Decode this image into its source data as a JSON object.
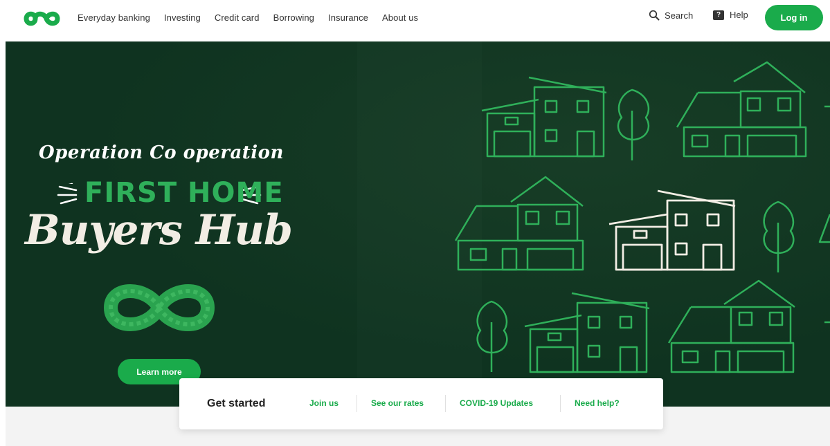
{
  "header": {
    "nav": [
      {
        "label": "Everyday banking"
      },
      {
        "label": "Investing"
      },
      {
        "label": "Credit card"
      },
      {
        "label": "Borrowing"
      },
      {
        "label": "Insurance"
      },
      {
        "label": "About us"
      }
    ],
    "search_label": "Search",
    "help_label": "Help",
    "login_label": "Log in"
  },
  "hero": {
    "script_line": "Operation Co operation",
    "first_home": "FIRST HOME",
    "buyers_hub": "Buyers Hub",
    "cta_label": "Learn more"
  },
  "quick_links": {
    "title": "Get started",
    "links": [
      {
        "label": "Join us"
      },
      {
        "label": "See our rates"
      },
      {
        "label": "COVID-19 Updates"
      },
      {
        "label": "Need help?"
      }
    ]
  },
  "colors": {
    "brand_green": "#1aab4b",
    "hero_background": "#0f3320",
    "house_line": "#2fb05a"
  }
}
